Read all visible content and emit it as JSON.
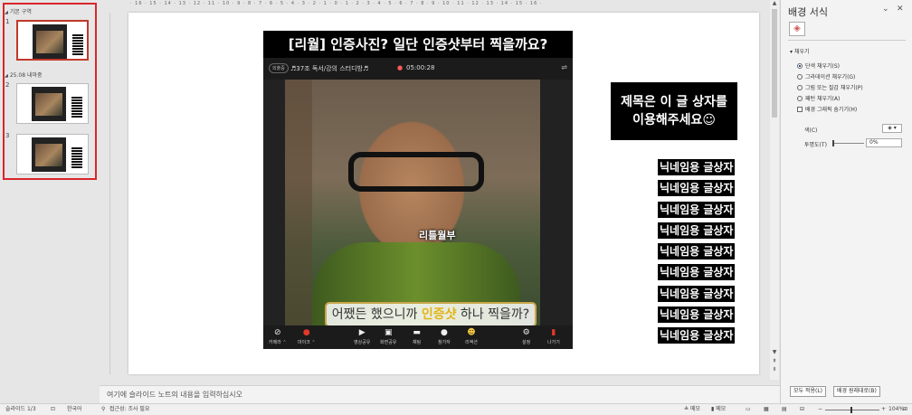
{
  "thumbnail_pane": {
    "sections": [
      {
        "label": "기본 구역"
      },
      {
        "label": "25.08 내마중"
      }
    ],
    "slides": [
      {
        "number": "1"
      },
      {
        "number": "2"
      },
      {
        "number": "3"
      }
    ]
  },
  "ruler": {
    "top": "· 16 · 15 · 14 · 13 · 12 · 11 · 10 · 9 · 8 · 7 · 6 · 5 · 4 · 3 · 2 · 1 · 0 · 1 · 2 · 3 · 4 · 5 · 6 · 7 · 8 · 9 · 10 · 11 · 12 · 13 · 14 · 15 · 16 ·"
  },
  "slide": {
    "video_title": "[리월] 인증사진? 일단 인증샷부터 찍을까요?",
    "topbar": {
      "pill": "외출중",
      "room": "♬37조 독서/강의 스터디방♬",
      "timer": "05:00:28"
    },
    "caption_name": "리틀월부",
    "caption_sub": {
      "before": "어쨌든 했으니까 ",
      "highlight": "인증샷",
      "after": " 하나 찍을까?"
    },
    "toolbar": [
      {
        "icon": "camera-off-icon",
        "label": "카메라 ⌃"
      },
      {
        "icon": "mic-off-icon",
        "label": "마이크 ⌃"
      },
      {
        "icon": "video-share-icon",
        "label": "영상공유"
      },
      {
        "icon": "screen-share-icon",
        "label": "화면공유"
      },
      {
        "icon": "chat-icon",
        "label": "채팅"
      },
      {
        "icon": "participants-icon",
        "label": "참가자"
      },
      {
        "icon": "reaction-icon",
        "label": "리액션"
      },
      {
        "icon": "settings-icon",
        "label": "설정"
      },
      {
        "icon": "exit-icon",
        "label": "나가기"
      }
    ],
    "title_box": [
      "제목은 이 글 상자를",
      "이용해주세요☺"
    ],
    "nickname_label": "닉네임용 글상자",
    "nickname_count": 9
  },
  "notes": {
    "placeholder": "여기에 슬라이드 노트의 내용을 입력하십시오"
  },
  "format_pane": {
    "title": "배경 서식",
    "section": "채우기",
    "options": [
      {
        "label": "단색 채우기(S)",
        "checked": true
      },
      {
        "label": "그라데이션 채우기(G)",
        "checked": false
      },
      {
        "label": "그림 또는 질감 채우기(P)",
        "checked": false
      },
      {
        "label": "패턴 채우기(A)",
        "checked": false
      }
    ],
    "hide_graphics": "배경 그래픽 숨기기(H)",
    "color_label": "색(C)",
    "transparency_label": "투명도(T)",
    "transparency_value": "0%",
    "apply_all": "모두 적용(L)",
    "reset": "배경 원래대로(B)"
  },
  "status_bar": {
    "slide_info": "슬라이드 1/3",
    "language": "한국어",
    "accessibility": "접근성: 조사 필요",
    "notes": "메모",
    "comments": "메모",
    "zoom": "104%"
  }
}
